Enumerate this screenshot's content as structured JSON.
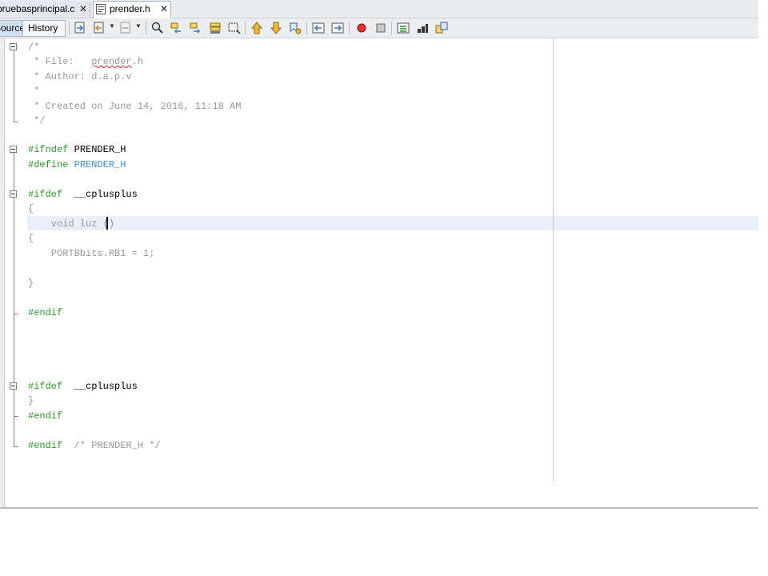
{
  "tabs": [
    {
      "label": "pruebasprincipal.c",
      "close": "✕",
      "active": false
    },
    {
      "label": "prender.h",
      "close": "✕",
      "active": true,
      "icon": "header-file-icon"
    }
  ],
  "view_tabs": {
    "source": "Source",
    "history": "History"
  },
  "toolbar_icons": [
    "last-edit-icon",
    "back-icon",
    "forward-icon",
    "find-selection-icon",
    "find-previous-icon",
    "find-next-icon",
    "toggle-highlight-icon",
    "toggle-rect-select-icon",
    "previous-bookmark-icon",
    "next-bookmark-icon",
    "toggle-bookmark-icon",
    "shift-left-icon",
    "shift-right-icon",
    "start-macro-icon",
    "stop-macro-icon",
    "comment-icon",
    "uncomment-icon",
    "diff-icon"
  ],
  "code": {
    "l1": "/*",
    "l2a": " * File:   ",
    "l2b": "prender",
    "l2c": ".h",
    "l3": " * Author: d.a.p.v",
    "l4": " *",
    "l5": " * Created on June 14, 2016, 11:18 AM",
    "l6": " */",
    "l7a": "#ifndef",
    "l7b": " PRENDER_H",
    "l8a": "#define",
    "l8b": " PRENDER_H",
    "l9a": "#ifdef",
    "l9b": "  __cplusplus",
    "l10": "{",
    "l11": "    void luz ()",
    "l12": "{",
    "l13": "    PORTBbits.RB1 = 1;",
    "l14": "}",
    "l15": "#endif",
    "l16a": "#ifdef",
    "l16b": "  __cplusplus",
    "l17": "}",
    "l18": "#endif",
    "l19a": "#endif",
    "l19b": "  /* PRENDER_H */"
  },
  "colors": {
    "keyword": "#2b9a2b",
    "macro": "#3c8fd0",
    "comment": "#969696",
    "current_line": "#e9eff8",
    "margin_line": "#f2b8b8"
  }
}
